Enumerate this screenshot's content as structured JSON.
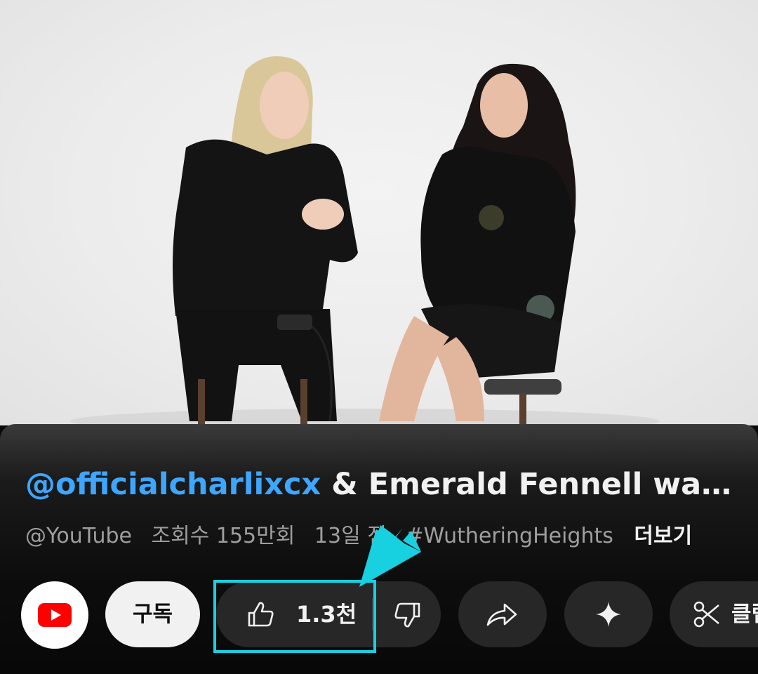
{
  "video": {
    "description_icon": "video-frame"
  },
  "title": {
    "mention": "@officialcharlixcx",
    "rest": " & Emerald Fennell wat..."
  },
  "meta": {
    "channel": "@YouTube",
    "views": "조회수 155만회",
    "age": "13일 전",
    "hashtag": "#WutheringHeights",
    "more": "더보기"
  },
  "actions": {
    "subscribe_label": "구독",
    "like_count": "1.3천",
    "clip_label": "클립"
  },
  "icons": {
    "channel": "youtube-logo-icon",
    "like": "thumbs-up-icon",
    "dislike": "thumbs-down-icon",
    "share": "share-arrow-icon",
    "ask": "sparkle-icon",
    "clip": "scissors-icon"
  },
  "colors": {
    "accent_mention": "#3ea6ff",
    "youtube_red": "#ff0000",
    "highlight": "#17d0e0"
  }
}
